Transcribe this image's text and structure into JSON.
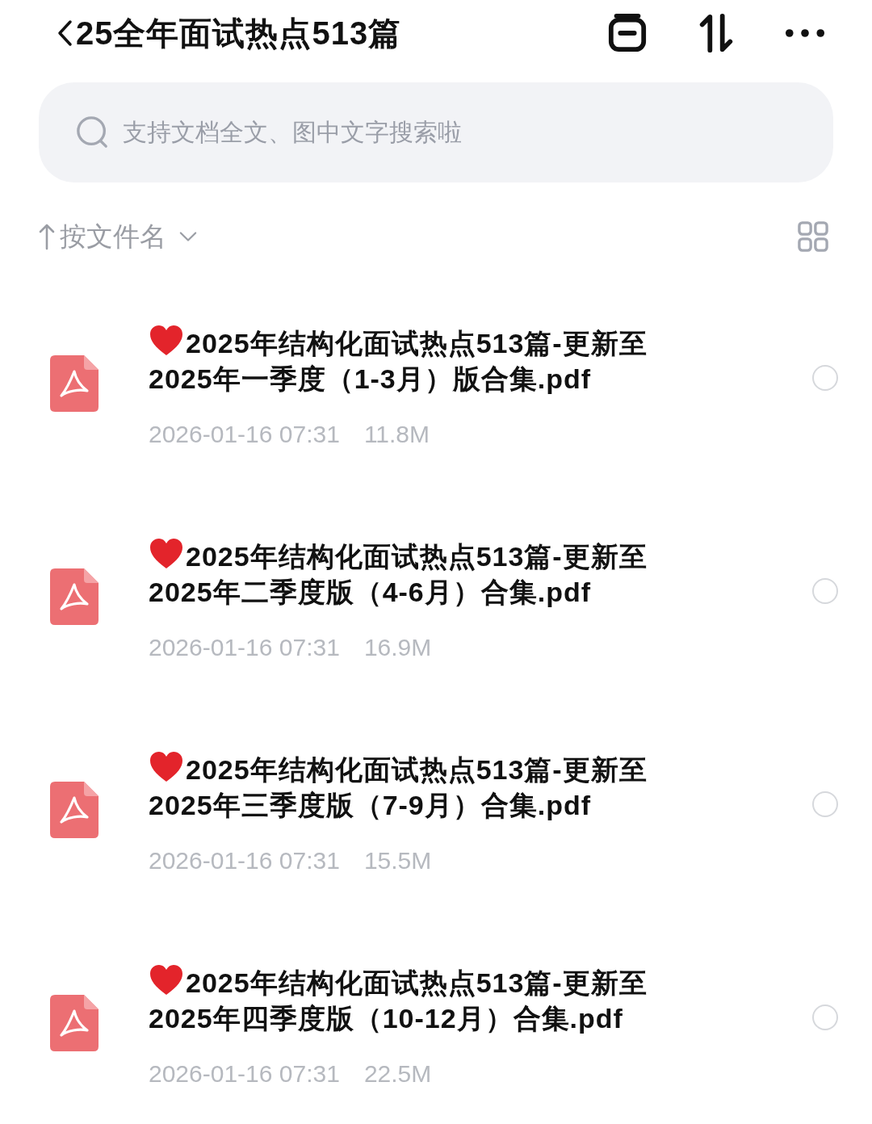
{
  "header": {
    "title": "25全年面试热点513篇"
  },
  "search": {
    "placeholder": "支持文档全文、图中文字搜索啦"
  },
  "sort": {
    "label": "按文件名"
  },
  "files": [
    {
      "name": "2025年结构化面试热点513篇-更新至2025年一季度（1-3月）版合集.pdf",
      "favorite": true,
      "date": "2026-01-16 07:31",
      "size": "11.8M",
      "selected": false
    },
    {
      "name": "2025年结构化面试热点513篇-更新至2025年二季度版（4-6月）合集.pdf",
      "favorite": true,
      "date": "2026-01-16 07:31",
      "size": "16.9M",
      "selected": false
    },
    {
      "name": "2025年结构化面试热点513篇-更新至2025年三季度版（7-9月）合集.pdf",
      "favorite": true,
      "date": "2026-01-16 07:31",
      "size": "15.5M",
      "selected": false
    },
    {
      "name": "2025年结构化面试热点513篇-更新至2025年四季度版（10-12月）合集.pdf",
      "favorite": true,
      "date": "2026-01-16 07:31",
      "size": "22.5M",
      "selected": false
    }
  ]
}
